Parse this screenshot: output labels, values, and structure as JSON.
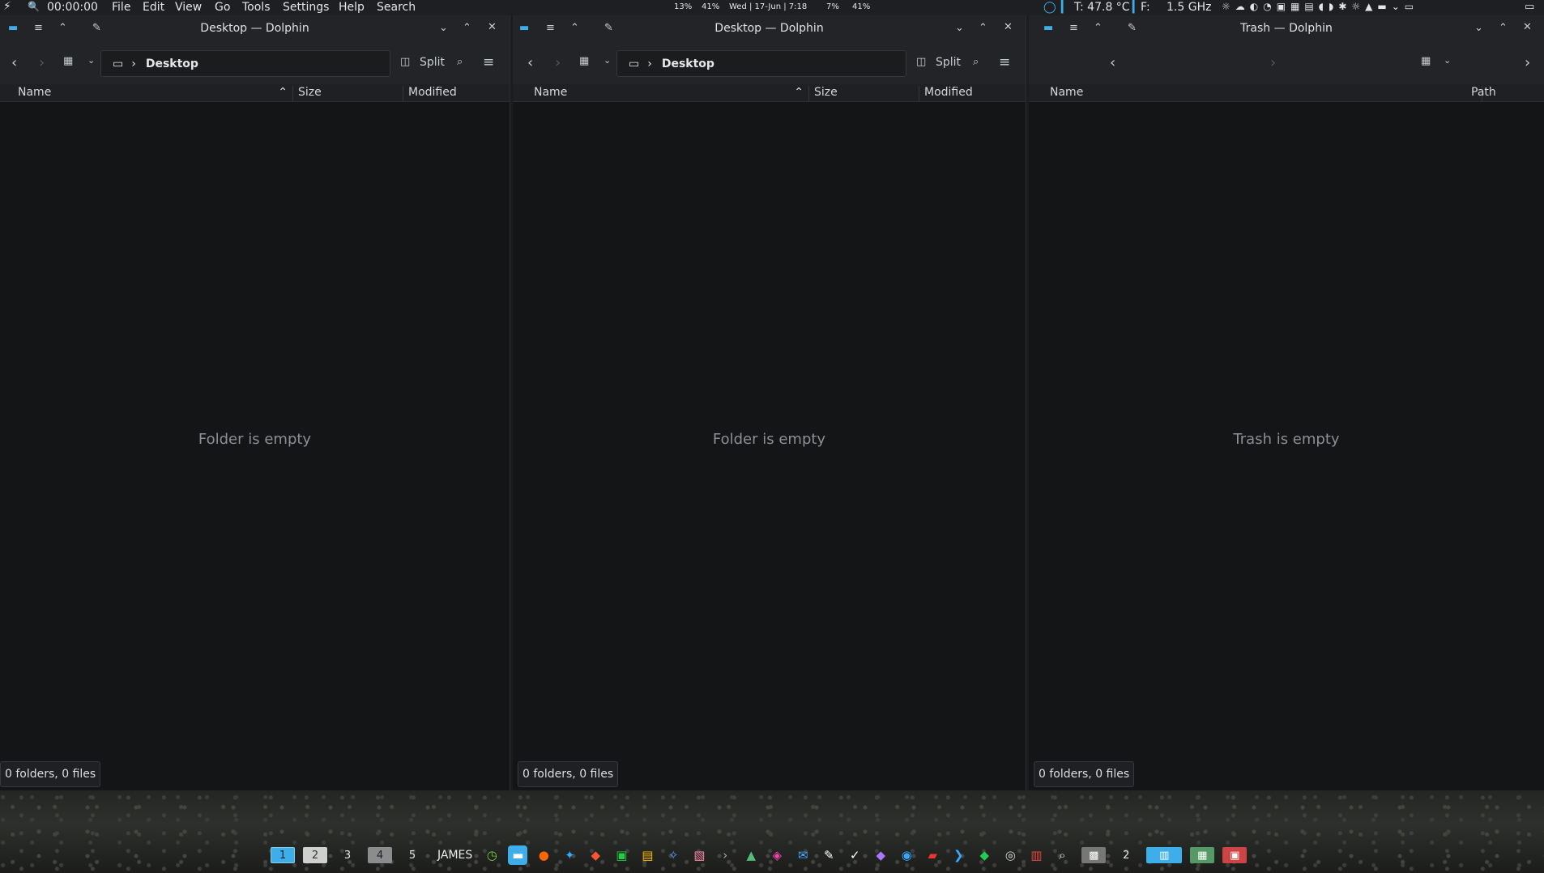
{
  "topbar": {
    "clock": "00:00:00",
    "menus": [
      "File",
      "Edit",
      "View",
      "Go",
      "Tools",
      "Settings",
      "Help",
      "Search"
    ],
    "stats": [
      "13%",
      "41%",
      "Wed | 17-Jun | 7:18",
      "7%",
      "41%"
    ],
    "temp": "T: 47.8 °C",
    "fan": "F:",
    "freq": "1.5 GHz"
  },
  "windows": [
    {
      "title": "Desktop — Dolphin",
      "crumb": "Desktop",
      "split": "Split",
      "cols": [
        "Name",
        "Size",
        "Modified"
      ],
      "empty": "Folder is empty",
      "status": "0 folders, 0 files"
    },
    {
      "title": "Desktop — Dolphin",
      "crumb": "Desktop",
      "split": "Split",
      "cols": [
        "Name",
        "Size",
        "Modified"
      ],
      "empty": "Folder is empty",
      "status": "0 folders, 0 files"
    },
    {
      "title": "Trash — Dolphin",
      "cols": [
        "Name",
        "Path"
      ],
      "empty": "Trash is empty",
      "status": "0 folders, 0 files"
    }
  ],
  "panel": {
    "workspaces": [
      "1",
      "2",
      "3",
      "4",
      "5"
    ],
    "user": "JAMES",
    "desk2": "2"
  },
  "colors": {
    "accent": "#3daee9",
    "bg": "#141517"
  }
}
